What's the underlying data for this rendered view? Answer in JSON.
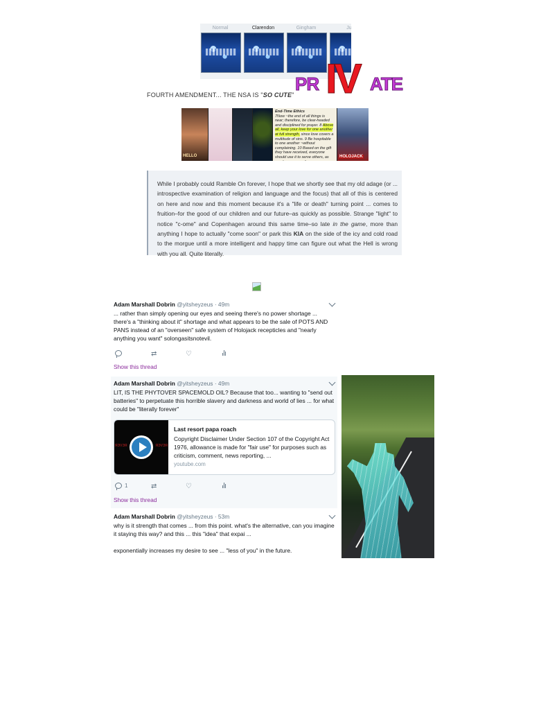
{
  "filters": [
    {
      "label": "Normal",
      "active": false
    },
    {
      "label": "Clarendon",
      "active": true
    },
    {
      "label": "Gingham",
      "active": false
    },
    {
      "label": "Ju",
      "active": false
    }
  ],
  "logo": {
    "pr": "PR",
    "iv": "IV",
    "ate": "ATE"
  },
  "fourth_amendment": {
    "prefix": "FOURTH AMENDMENT... THE NSA IS \"",
    "emphasis": "SO CUTE",
    "suffix": "\""
  },
  "collage": {
    "poster_text": "HELLO",
    "end_time_heading": "End-Time Ethics",
    "end_time_text_1": "7Now ~the end of all things is near; therefore, be clear-headed and disciplined for prayer. 8 ",
    "end_time_hl_1": "Above all, keep your love for one another at full strength,",
    "end_time_text_2": " since love covers a multitude of sins. 9 Be hospitable to one another ~without complaining. 10 Based on the gift they have received, everyone should use it to serve others, as good managers of",
    "badge_text": "HOLOJACK"
  },
  "quote": {
    "part1": "While I probably could Ramble On forever, I hope that we shortly see that my old adage (or ... introspective examination of religion and language and the focus) that all of this is centered on here and now and this moment because it's a \"life or death\" turning point ... comes to fruition–for the good of our children and our future–as quickly as possible. Strange \"light\" to notice \"c-ome\" and Copenhagen around this same time–so late ",
    "italic": "in the game",
    "part2": ", more than anything I hope to actually \"come soon\" or park this ",
    "bold": "KIA",
    "part3": " on the side of the icy and cold road to the morgue until a more intelligent and happy time can figure out what the Hell is wrong with you all. Quite literally."
  },
  "tweets": [
    {
      "name": "Adam Marshall Dobrin",
      "handle": "@yitsheyzeus",
      "time": "· 49m",
      "text": "... rather than simply opening our eyes and seeing there's no power shortage ... there's a \"thinking about it\" shortage and what appears to be the sale of POTS AND PANS instead of an \"overseen\" safe system of Holojack recepticles and \"nearly anything you want\" solongasitsnotevil.",
      "reply_count": "",
      "show_thread": "Show this thread"
    },
    {
      "name": "Adam Marshall Dobrin",
      "handle": "@yitsheyzeus",
      "time": "· 49m",
      "text": "LIT, IS THE PHYTOVER SPACEMOLD OIL?  Because that too... wanting to \"send out batteries\" to perpetuate this horrible slavery and darkness and world of lies ... for what could be \"literally forever\"",
      "card": {
        "title": "Last resort papa roach",
        "description": "Copyright Disclaimer Under Section 107 of the Copyright Act 1976, allowance is made for \"fair use\" for purposes such as criticism, comment, news reporting, ...",
        "url": "youtube.com",
        "thumb_left": "ЯЭVЭЯ",
        "thumb_right": "ЯЭVЭЯ"
      },
      "reply_count": "1",
      "show_thread": "Show this thread"
    },
    {
      "name": "Adam Marshall Dobrin",
      "handle": "@yitsheyzeus",
      "time": "· 53m",
      "text": "why is it strength that comes ... from this point.  what's the alternative, can you imagine it staying this way?  and this ... this \"idea\" that expai ...\n\nexponentially increases my desire to see ... \"less of you\" in the future."
    }
  ],
  "icons": {
    "reply": "reply-icon",
    "retweet": "retweet-icon",
    "like": "heart-icon",
    "stats": "analytics-icon",
    "more": "chevron-down-icon"
  }
}
